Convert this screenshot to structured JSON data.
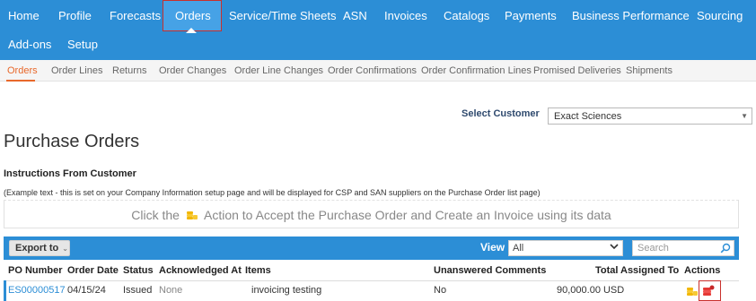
{
  "topnav": {
    "items": [
      "Home",
      "Profile",
      "Forecasts",
      "Orders",
      "Service/Time Sheets",
      "ASN",
      "Invoices",
      "Catalogs",
      "Payments",
      "Business Performance",
      "Sourcing",
      "Add-ons",
      "Setup"
    ],
    "active": "Orders"
  },
  "subnav": {
    "items": [
      "Orders",
      "Order Lines",
      "Returns",
      "Order Changes",
      "Order Line Changes",
      "Order Confirmations",
      "Order Confirmation Lines",
      "Promised Deliveries",
      "Shipments"
    ],
    "active": "Orders"
  },
  "customer": {
    "label": "Select Customer",
    "value": "Exact Sciences"
  },
  "page": {
    "title": "Purchase Orders"
  },
  "instructions": {
    "title": "Instructions From Customer",
    "text": "(Example text - this is set on your Company Information setup page and will be displayed for CSP and SAN suppliers on the Purchase Order list page)",
    "banner_before": "Click the",
    "banner_after": "Action to Accept the Purchase Order and Create an Invoice using its data"
  },
  "toolbar": {
    "export_label": "Export to",
    "view_label": "View",
    "view_value": "All",
    "search_placeholder": "Search"
  },
  "table": {
    "columns": [
      "PO Number",
      "Order Date",
      "Status",
      "Acknowledged At",
      "Items",
      "Unanswered Comments",
      "Total",
      "Assigned To",
      "Actions"
    ],
    "rows": [
      {
        "po_number": "ES00000517",
        "order_date": "04/15/24",
        "status": "Issued",
        "acknowledged_at": "None",
        "items": "invoicing testing",
        "unanswered_comments": "No",
        "total": "90,000.00 USD",
        "assigned_to": "",
        "actions": [
          "accept-invoice-icon",
          "reject-icon"
        ]
      }
    ]
  },
  "colors": {
    "brand_blue": "#2c8ed6",
    "active_orange": "#e8682b",
    "highlight_red": "#c9302c",
    "coin_gold": "#f2b705"
  }
}
